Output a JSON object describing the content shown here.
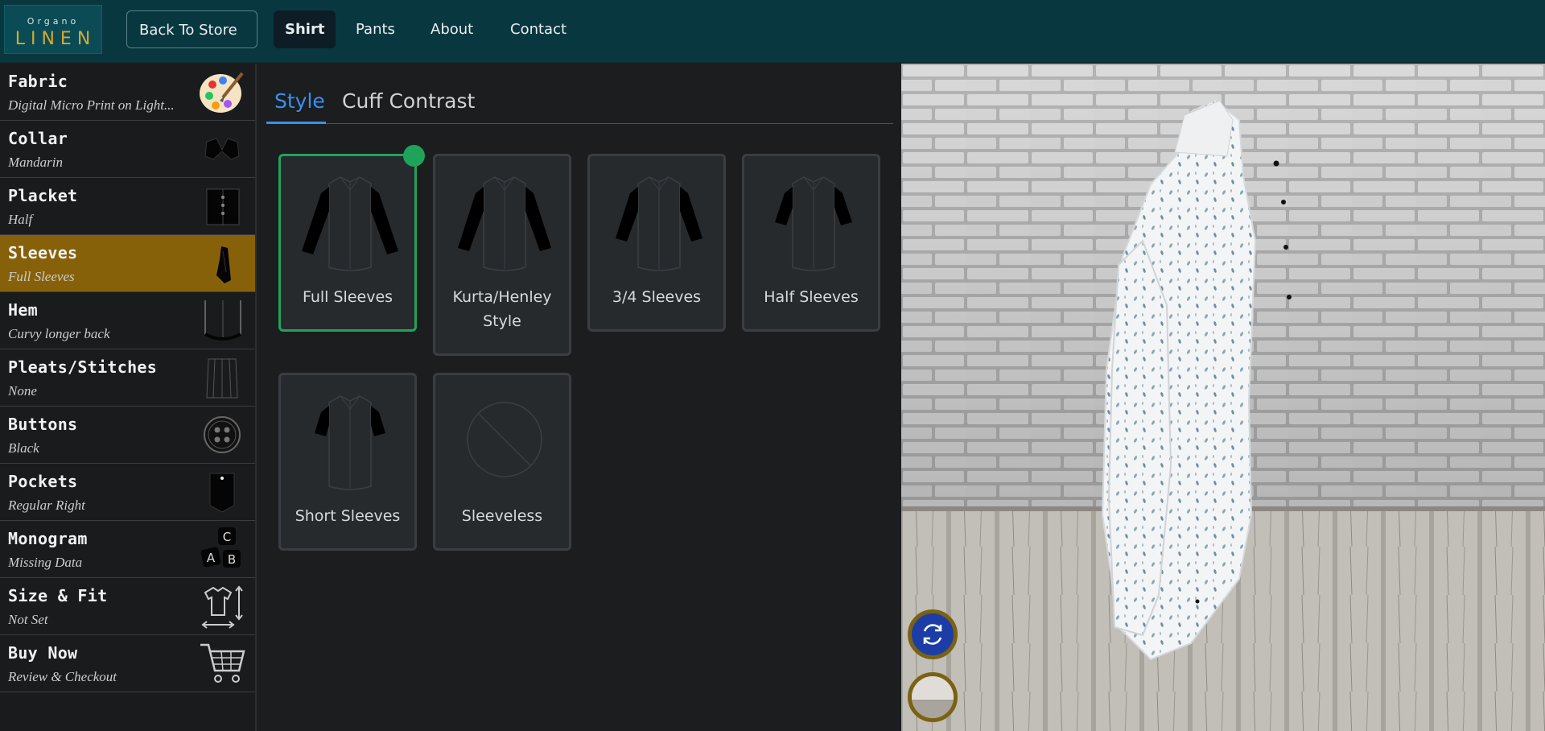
{
  "logo": {
    "line1": "Organo",
    "line2": "LINEN"
  },
  "topnav": {
    "back_label": "Back To Store",
    "back_icon": "external-arrow-icon",
    "items": [
      "Shirt",
      "Pants",
      "About",
      "Contact"
    ],
    "active": "Shirt"
  },
  "sidebar": {
    "items": [
      {
        "title": "Fabric",
        "value": "Digital Micro Print on Light...",
        "icon": "palette-icon"
      },
      {
        "title": "Collar",
        "value": "Mandarin",
        "icon": "collar-icon"
      },
      {
        "title": "Placket",
        "value": "Half",
        "icon": "placket-icon"
      },
      {
        "title": "Sleeves",
        "value": "Full Sleeves",
        "icon": "sleeve-icon",
        "active": true
      },
      {
        "title": "Hem",
        "value": "Curvy longer back",
        "icon": "hem-icon"
      },
      {
        "title": "Pleats/Stitches",
        "value": "None",
        "icon": "pleats-icon"
      },
      {
        "title": "Buttons",
        "value": "Black",
        "icon": "button-icon"
      },
      {
        "title": "Pockets",
        "value": "Regular Right",
        "icon": "pocket-icon"
      },
      {
        "title": "Monogram",
        "value": "Missing Data",
        "icon": "letter-blocks-icon"
      },
      {
        "title": "Size & Fit",
        "value": "Not Set",
        "icon": "size-fit-icon"
      },
      {
        "title": "Buy Now",
        "value": "Review & Checkout",
        "icon": "cart-icon"
      }
    ]
  },
  "tabs": {
    "style": "Style",
    "cuff": "Cuff Contrast",
    "active": "Style"
  },
  "options": [
    {
      "label": "Full Sleeves",
      "selected": true
    },
    {
      "label": "Kurta/Henley Style",
      "selected": false
    },
    {
      "label": "3/4 Sleeves",
      "selected": false
    },
    {
      "label": "Half Sleeves",
      "selected": false
    },
    {
      "label": "Short Sleeves",
      "selected": false
    },
    {
      "label": "Sleeveless",
      "selected": false
    }
  ],
  "viewer": {
    "rotate_icon": "rotate-icon",
    "background_icon": "background-scene-icon"
  },
  "colors": {
    "topbar": "#093740",
    "accent_gold": "#87610a",
    "selected_green": "#1fa35a",
    "tab_blue": "#3a8ff0"
  }
}
